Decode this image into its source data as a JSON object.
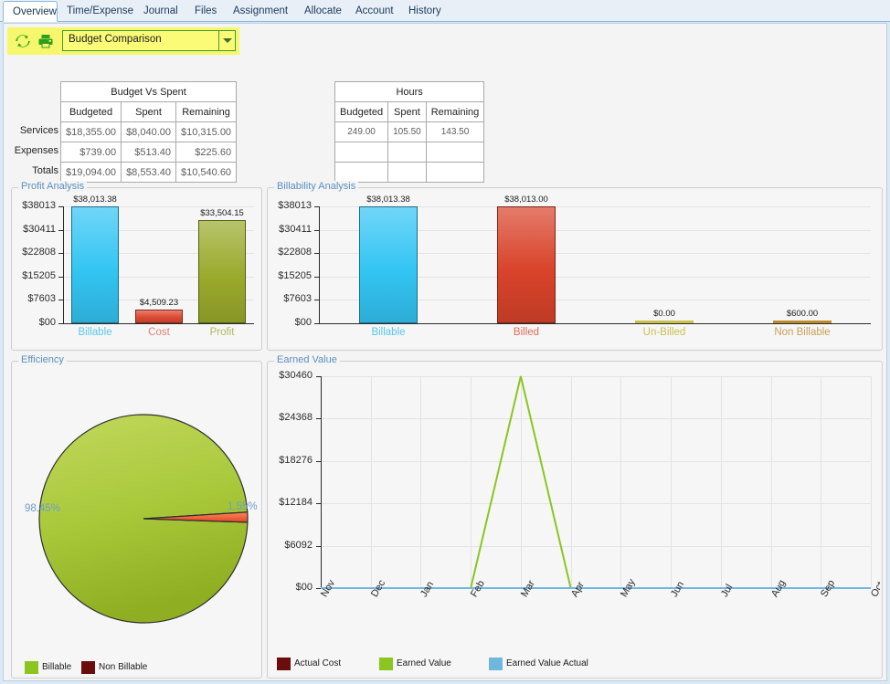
{
  "tabs": [
    {
      "label": "Overview",
      "active": true
    },
    {
      "label": "Time/Expense",
      "active": false
    },
    {
      "label": "Journal",
      "active": false
    },
    {
      "label": "Files",
      "active": false
    },
    {
      "label": "Assignment",
      "active": false
    },
    {
      "label": "Allocate",
      "active": false
    },
    {
      "label": "Account",
      "active": false
    },
    {
      "label": "History",
      "active": false
    }
  ],
  "toolbar": {
    "refresh_icon": "refresh-icon",
    "print_icon": "print-icon",
    "report_select_value": "Budget Comparison",
    "dropdown_arrow": "chevron-down-icon"
  },
  "summary": {
    "budget_group_header": "Budget Vs Spent",
    "hours_group_header": "Hours",
    "columns": [
      "Budgeted",
      "Spent",
      "Remaining"
    ],
    "row_labels": [
      "Services",
      "Expenses",
      "Totals"
    ],
    "budget_rows": [
      [
        "$18,355.00",
        "$8,040.00",
        "$10,315.00"
      ],
      [
        "$739.00",
        "$513.40",
        "$225.60"
      ],
      [
        "$19,094.00",
        "$8,553.40",
        "$10,540.60"
      ]
    ],
    "hours_rows": [
      [
        "249.00",
        "105.50",
        "143.50"
      ],
      [
        "",
        "",
        ""
      ],
      [
        "",
        "",
        ""
      ]
    ]
  },
  "profit_panel_title": "Profit Analysis",
  "billability_panel_title": "Billability Analysis",
  "efficiency_panel_title": "Efficiency",
  "earned_panel_title": "Earned Value",
  "chart_data": [
    {
      "type": "bar",
      "title": "Profit Analysis",
      "categories": [
        "Billable",
        "Cost",
        "Profit"
      ],
      "values": [
        38013.38,
        4509.23,
        33504.15
      ],
      "data_labels": [
        "$38,013.38",
        "$4,509.23",
        "$33,504.15"
      ],
      "bar_colors": [
        "#33c5f3",
        "#dd4a33",
        "#9aaa2b"
      ],
      "label_colors": [
        "#56c7ef",
        "#e38073",
        "#b0b957"
      ],
      "ytick_labels": [
        "$00",
        "$7603",
        "$15205",
        "$22808",
        "$30411",
        "$38013"
      ],
      "ytick_values": [
        0,
        7603,
        15205,
        22808,
        30411,
        38013
      ],
      "ylim": [
        0,
        38013
      ],
      "xlabel": "",
      "ylabel": "",
      "grid": true,
      "legend": "none"
    },
    {
      "type": "bar",
      "title": "Billability Analysis",
      "categories": [
        "Billable",
        "Billed",
        "Un-Billed",
        "Non Billable"
      ],
      "values": [
        38013.38,
        38013.0,
        0.0,
        600.0
      ],
      "data_labels": [
        "$38,013.38",
        "$38,013.00",
        "$0.00",
        "$600.00"
      ],
      "bar_colors": [
        "#33c5f3",
        "#d9432a",
        "#c9c14a",
        "#c08a28"
      ],
      "label_colors": [
        "#56c7ef",
        "#e06a55",
        "#c9c14a",
        "#c8a057"
      ],
      "ytick_labels": [
        "$00",
        "$7603",
        "$15205",
        "$22808",
        "$30411",
        "$38013"
      ],
      "ytick_values": [
        0,
        7603,
        15205,
        22808,
        30411,
        38013
      ],
      "ylim": [
        0,
        38013
      ],
      "xlabel": "",
      "ylabel": "",
      "grid": true,
      "legend": "none"
    },
    {
      "type": "pie",
      "title": "Efficiency",
      "labels": [
        "Billable",
        "Non Billable"
      ],
      "values": [
        98.45,
        1.55
      ],
      "data_labels": [
        "98.45%",
        "1.55%"
      ],
      "slice_colors": [
        "#a2c63a",
        "#f4603a"
      ],
      "legend_colors": [
        "#8cc520",
        "#6b0d0d"
      ],
      "legend": "bottom-left"
    },
    {
      "type": "line",
      "title": "Earned Value",
      "x": [
        "Nov",
        "Dec",
        "Jan",
        "Feb",
        "Mar",
        "Apr",
        "May",
        "Jun",
        "Jul",
        "Aug",
        "Sep",
        "Oct"
      ],
      "series": [
        {
          "name": "Actual Cost",
          "color": "#6b0d0d",
          "values": [
            0,
            0,
            0,
            0,
            0,
            0,
            0,
            0,
            0,
            0,
            0,
            0
          ]
        },
        {
          "name": "Earned Value",
          "color": "#8cc520",
          "values": [
            0,
            0,
            0,
            0,
            30460,
            0,
            0,
            0,
            0,
            0,
            0,
            0
          ]
        },
        {
          "name": "Earned Value Actual",
          "color": "#6fb7dd",
          "values": [
            0,
            0,
            0,
            0,
            0,
            0,
            0,
            0,
            0,
            0,
            0,
            0
          ]
        }
      ],
      "ytick_labels": [
        "$00",
        "$6092",
        "$12184",
        "$18276",
        "$24368",
        "$30460"
      ],
      "ytick_values": [
        0,
        6092,
        12184,
        18276,
        24368,
        30460
      ],
      "ylim": [
        0,
        30460
      ],
      "xlabel": "",
      "ylabel": "",
      "grid": true,
      "legend": "bottom-left"
    }
  ]
}
